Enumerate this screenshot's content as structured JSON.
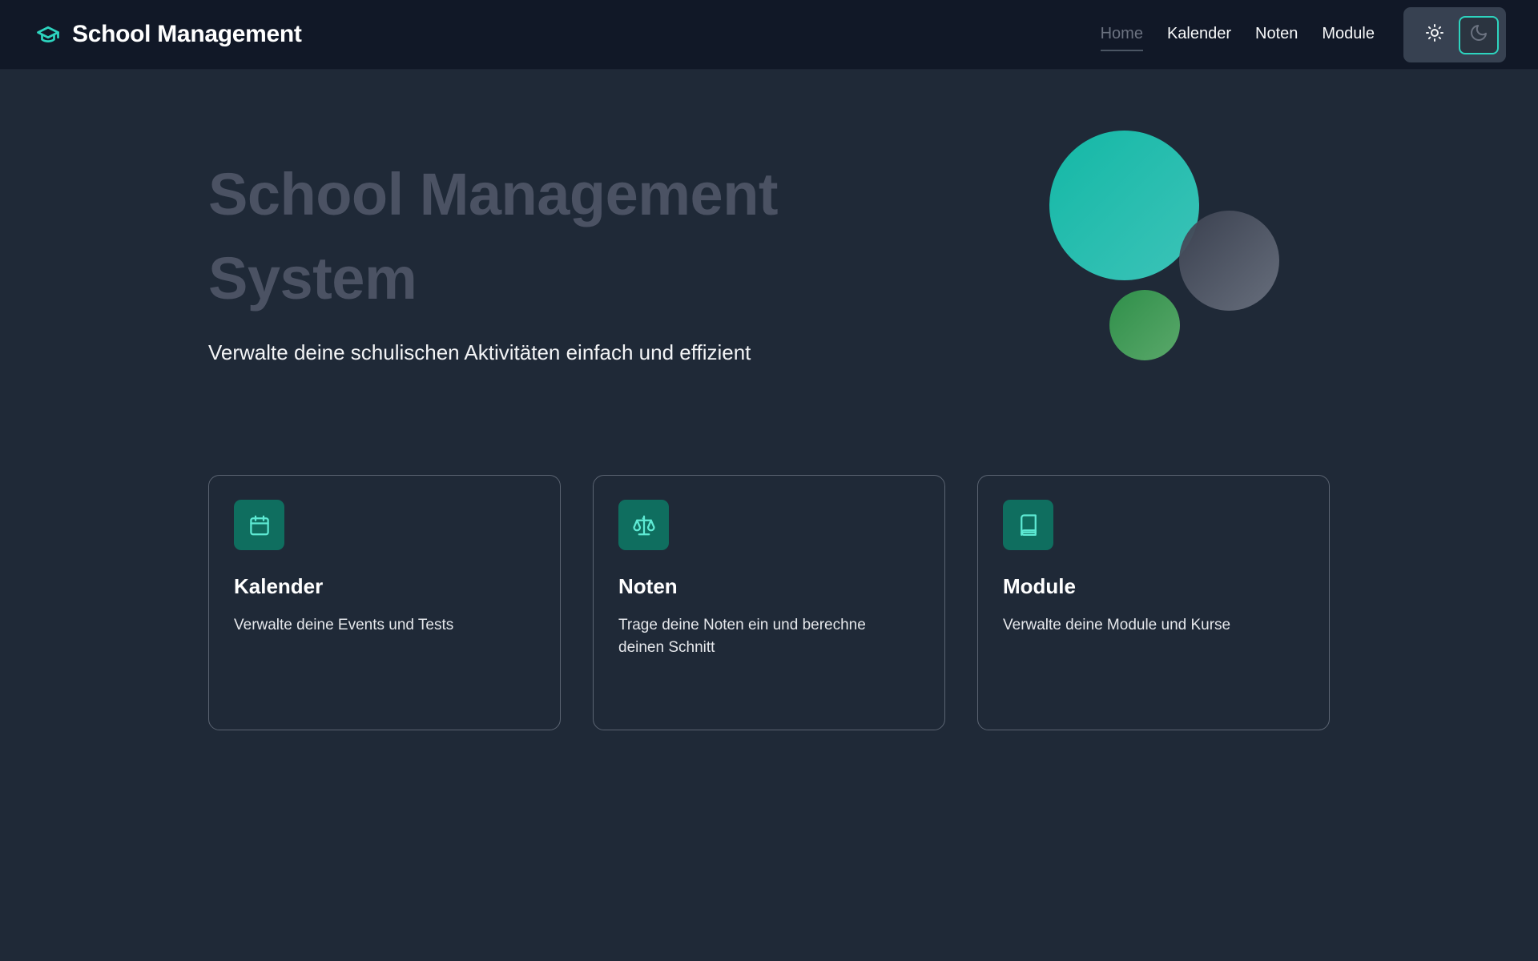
{
  "header": {
    "brand_icon": "graduation-cap-icon",
    "brand_title": "School Management",
    "nav": [
      {
        "label": "Home",
        "active": true
      },
      {
        "label": "Kalender",
        "active": false
      },
      {
        "label": "Noten",
        "active": false
      },
      {
        "label": "Module",
        "active": false
      }
    ],
    "theme_toggle": {
      "light_icon": "sun-icon",
      "dark_icon": "moon-icon",
      "selected": "dark"
    }
  },
  "hero": {
    "title_line1": "School Management",
    "title_line2": "System",
    "subtitle": "Verwalte deine schulischen Aktivitäten einfach und effizient"
  },
  "cards": [
    {
      "icon": "calendar-icon",
      "title": "Kalender",
      "description": "Verwalte deine Events und Tests"
    },
    {
      "icon": "scale-icon",
      "title": "Noten",
      "description": "Trage deine Noten ein und berechne deinen Schnitt"
    },
    {
      "icon": "book-icon",
      "title": "Module",
      "description": "Verwalte deine Module und Kurse"
    }
  ],
  "colors": {
    "background": "#1f2937",
    "header_bg": "#111827",
    "accent": "#2dd4bf",
    "icon_tile": "#0f6e5f"
  }
}
